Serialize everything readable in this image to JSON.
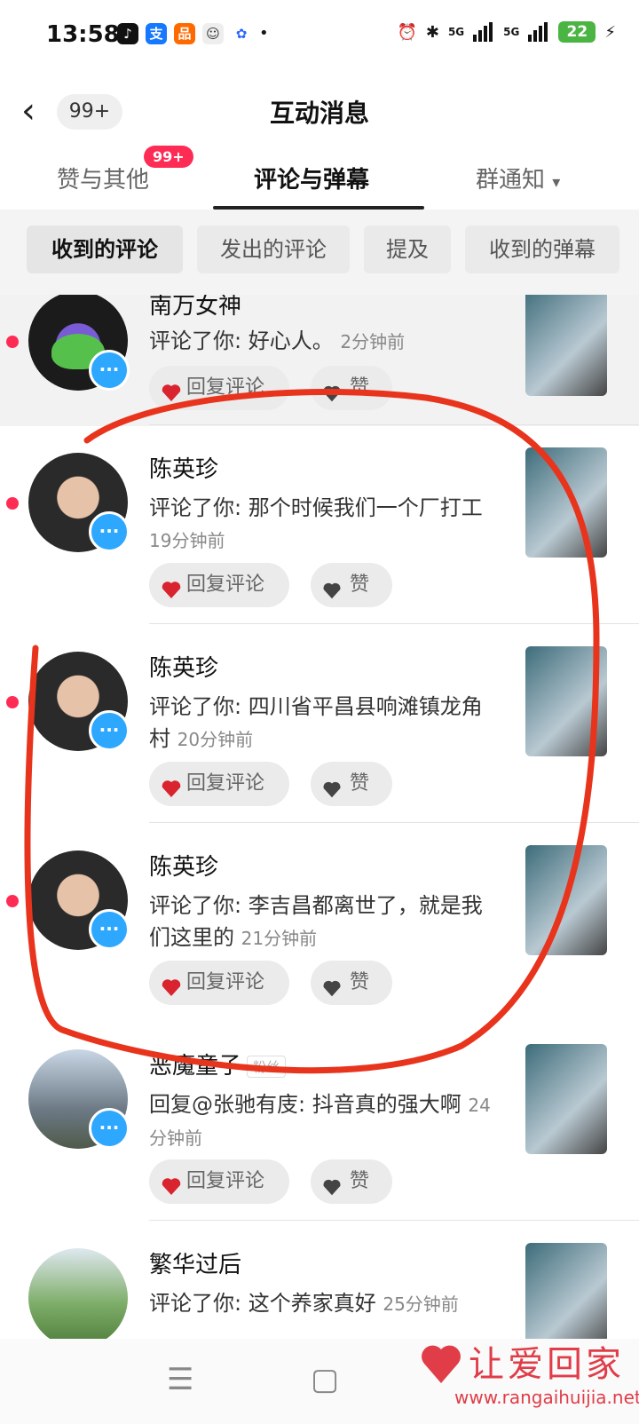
{
  "status_bar": {
    "time": "13:58",
    "network1": "5G",
    "network2": "5G",
    "battery": "22"
  },
  "header": {
    "back_count": "99+",
    "title": "互动消息"
  },
  "tabs": [
    {
      "label": "赞与其他",
      "badge": "99+"
    },
    {
      "label": "评论与弹幕",
      "active": true
    },
    {
      "label": "群通知",
      "dropdown": "▾"
    }
  ],
  "filter_chips": [
    {
      "label": "收到的评论",
      "active": true
    },
    {
      "label": "发出的评论"
    },
    {
      "label": "提及"
    },
    {
      "label": "收到的弹幕"
    }
  ],
  "actions": {
    "reply": "回复评论",
    "like": "赞"
  },
  "comments": [
    {
      "name": "南万女神",
      "text": "评论了你: 好心人。",
      "time": "2分钟前",
      "unread": true
    },
    {
      "name": "陈英珍",
      "text": "评论了你: 那个时候我们一个厂打工",
      "time": "19分钟前",
      "unread": true
    },
    {
      "name": "陈英珍",
      "text": "评论了你: 四川省平昌县响滩镇龙角村",
      "time": "20分钟前",
      "unread": true
    },
    {
      "name": "陈英珍",
      "text": "评论了你: 李吉昌都离世了，就是我们这里的",
      "time": "21分钟前",
      "unread": true
    },
    {
      "name": "恶魔童子",
      "fan_badge": "粉丝",
      "text": "回复@张驰有庋: 抖音真的强大啊",
      "time": "24分钟前",
      "unread": false
    },
    {
      "name": "繁华过后",
      "text": "评论了你: 这个养家真好",
      "time": "25分钟前",
      "unread": false
    }
  ],
  "watermark": {
    "title": "让爱回家",
    "url": "www.rangaihuijia.net"
  },
  "colors": {
    "accent": "#fe2c55",
    "annotation": "#e8341c",
    "badge_blue": "#2ea7ff"
  }
}
